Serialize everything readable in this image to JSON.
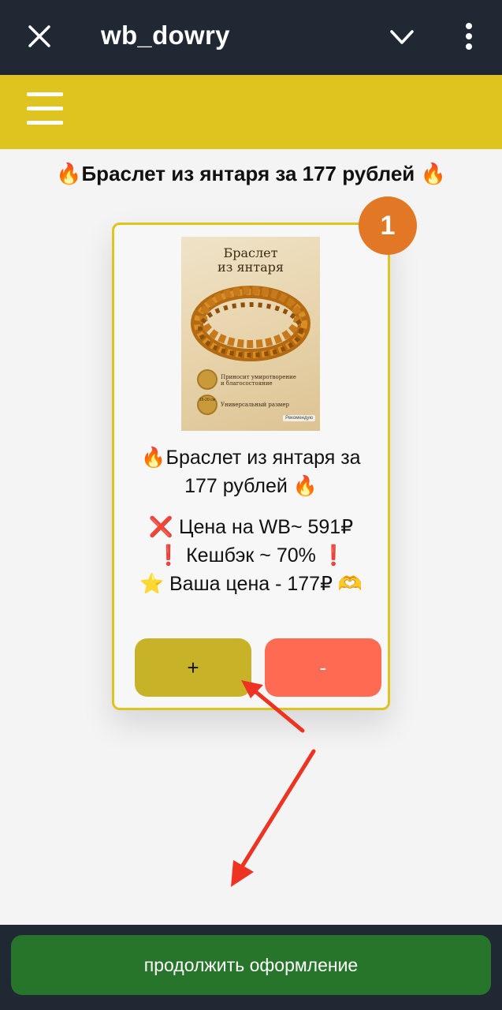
{
  "header": {
    "title": "wb_dowry"
  },
  "page": {
    "title": "🔥Браслет из янтаря за 177 рублей 🔥"
  },
  "card": {
    "badge_count": "1",
    "image_title_line1": "Браслет",
    "image_title_line2": "из янтаря",
    "image_feature1_line1": "Приносит умиротворение",
    "image_feature1_line2": "и благосостояние",
    "image_feature2": "Универсальный размер",
    "image_size_label": "16-20 см",
    "image_tag": "Рекомендую",
    "name_line1": "🔥Браслет из янтаря за",
    "name_line2": "177 рублей 🔥",
    "price_wb": "❌ Цена на WB~ 591₽",
    "cashback": "❗ Кешбэк ~ 70% ❗",
    "your_price": "⭐ Ваша цена - 177₽ 🫶",
    "plus_label": "+",
    "minus_label": "-"
  },
  "footer": {
    "continue_label": "продолжить оформление"
  },
  "colors": {
    "topbar": "#1f2833",
    "accent_yellow": "#dfc41f",
    "badge": "#e27725",
    "minus": "#ff6b52",
    "continue": "#27752a"
  },
  "icons": [
    "close-icon",
    "chevron-down-icon",
    "more-vert-icon",
    "menu-icon"
  ]
}
